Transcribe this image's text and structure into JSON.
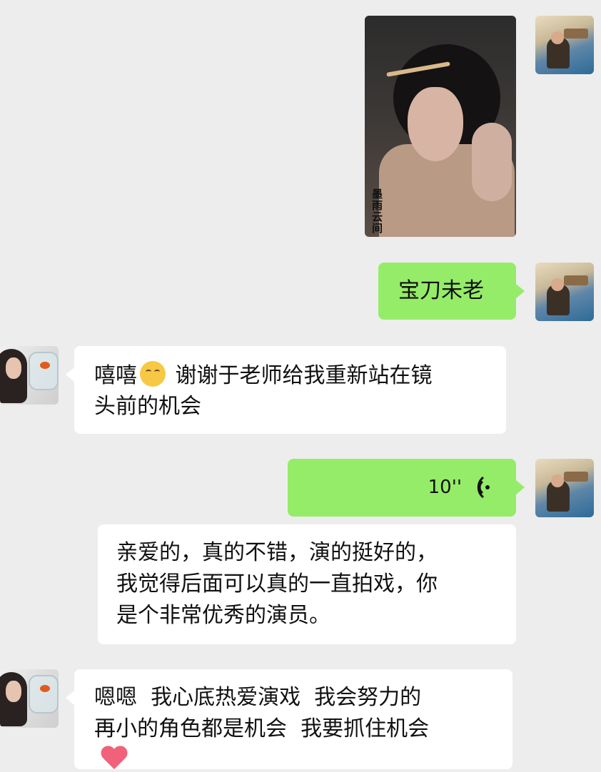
{
  "messages": [
    {
      "id": "m1",
      "side": "right",
      "type": "image"
    },
    {
      "id": "m2",
      "side": "right",
      "type": "text",
      "text": "宝刀未老"
    },
    {
      "id": "m3",
      "side": "left",
      "type": "text",
      "text_a": "嘻嘻",
      "text_b": " 谢谢于老师给我重新站在镜",
      "text_c": "头前的机会"
    },
    {
      "id": "m4",
      "side": "right",
      "type": "voice",
      "duration": "10''"
    },
    {
      "id": "m5",
      "side": "right",
      "type": "text",
      "lines": [
        "亲爱的，真的不错，演的挺好的，",
        "我觉得后面可以真的一直拍戏，你",
        "是个非常优秀的演员。"
      ]
    },
    {
      "id": "m6",
      "side": "left",
      "type": "text",
      "lines": [
        "嗯嗯  我心底热爱演戏  我会努力的",
        "再小的角色都是机会  我要抓住机会"
      ]
    }
  ],
  "photo_logo_text": "墨雨云间",
  "colors": {
    "background": "#ededed",
    "sent_bubble": "#95ec69",
    "received_bubble": "#ffffff",
    "heart": "#f0627a"
  },
  "icons": {
    "voice": "voice-wave-icon",
    "emoji": "smiling-face-icon",
    "heart": "red-heart-icon"
  }
}
